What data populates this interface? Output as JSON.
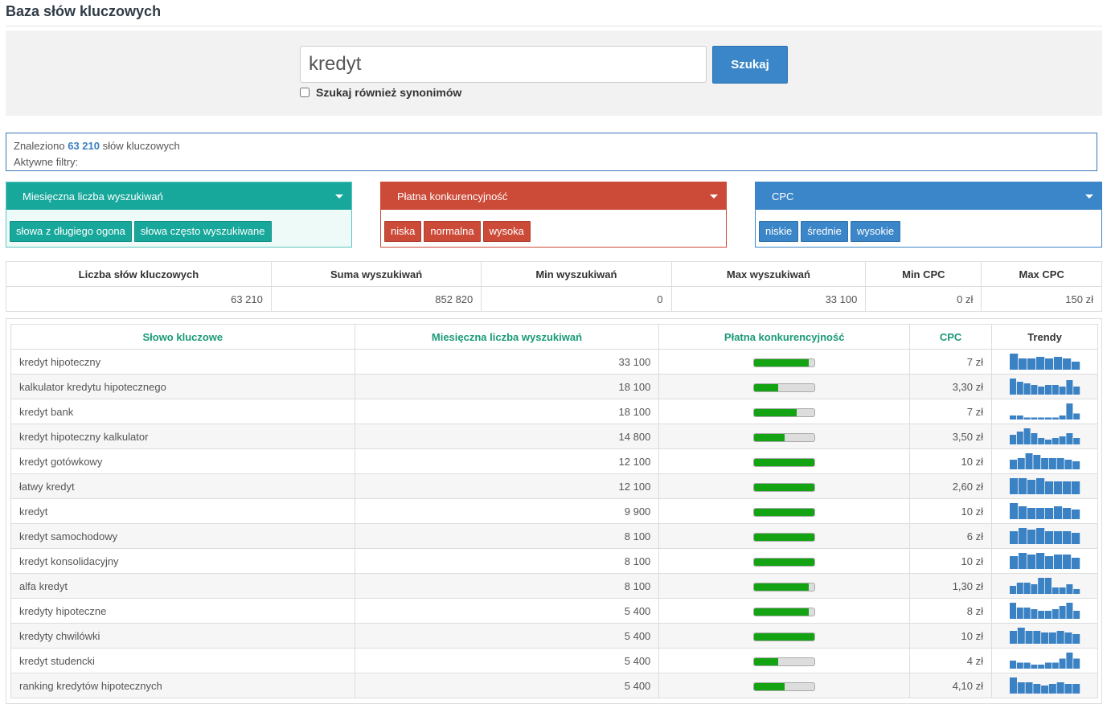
{
  "header": {
    "title": "Baza słów kluczowych"
  },
  "search": {
    "value": "kredyt",
    "button_label": "Szukaj",
    "synonyms_label": "Szukaj również synonimów"
  },
  "info": {
    "found_prefix": "Znaleziono",
    "found_count": "63 210",
    "found_suffix": "słów kluczowych",
    "active_filters": "Aktywne filtry:"
  },
  "filters": [
    {
      "title": "Miesięczna liczba wyszukiwań",
      "color": "#17a89b",
      "border": "#5cc7bd",
      "bg": "#eefaf8",
      "chips": [
        "słowa z długiego ogona",
        "słowa często wyszukiwane"
      ]
    },
    {
      "title": "Płatna konkurencyjność",
      "color": "#cc4a38",
      "border": "#cc4a38",
      "bg": "#fff",
      "chips": [
        "niska",
        "normalna",
        "wysoka"
      ]
    },
    {
      "title": "CPC",
      "color": "#3b86c8",
      "border": "#3b86c8",
      "bg": "#fff",
      "chips": [
        "niskie",
        "średnie",
        "wysokie"
      ]
    }
  ],
  "stats": {
    "headers": [
      "Liczba słów kluczowych",
      "Suma wyszukiwań",
      "Min wyszukiwań",
      "Max wyszukiwań",
      "Min CPC",
      "Max CPC"
    ],
    "values": [
      "63 210",
      "852 820",
      "0",
      "33 100",
      "0 zł",
      "150 zł"
    ]
  },
  "table": {
    "headers": [
      "Słowo kluczowe",
      "Miesięczna liczba wyszukiwań",
      "Płatna konkurencyjność",
      "CPC",
      "Trendy"
    ],
    "rows": [
      {
        "keyword": "kredyt hipoteczny",
        "searches": "33 100",
        "competition": 0.9,
        "cpc": "7 zł",
        "trend": [
          10,
          7,
          7,
          8,
          7,
          8,
          7,
          5
        ]
      },
      {
        "keyword": "kalkulator kredytu hipotecznego",
        "searches": "18 100",
        "competition": 0.4,
        "cpc": "3,30 zł",
        "trend": [
          10,
          8,
          7,
          6,
          5,
          6,
          6,
          5,
          9,
          5
        ]
      },
      {
        "keyword": "kredyt bank",
        "searches": "18 100",
        "competition": 0.7,
        "cpc": "7 zł",
        "trend": [
          2,
          2,
          1,
          1,
          1,
          1,
          1,
          2,
          8,
          3
        ]
      },
      {
        "keyword": "kredyt hipoteczny kalkulator",
        "searches": "14 800",
        "competition": 0.5,
        "cpc": "3,50 zł",
        "trend": [
          6,
          8,
          10,
          7,
          4,
          3,
          4,
          5,
          7,
          4
        ]
      },
      {
        "keyword": "kredyt gotówkowy",
        "searches": "12 100",
        "competition": 1.0,
        "cpc": "10 zł",
        "trend": [
          6,
          7,
          10,
          9,
          7,
          7,
          7,
          6,
          5
        ]
      },
      {
        "keyword": "łatwy kredyt",
        "searches": "12 100",
        "competition": 1.0,
        "cpc": "2,60 zł",
        "trend": [
          10,
          10,
          9,
          10,
          8,
          8,
          8,
          8
        ]
      },
      {
        "keyword": "kredyt",
        "searches": "9 900",
        "competition": 1.0,
        "cpc": "10 zł",
        "trend": [
          10,
          8,
          7,
          7,
          7,
          8,
          7,
          6
        ]
      },
      {
        "keyword": "kredyt samochodowy",
        "searches": "8 100",
        "competition": 1.0,
        "cpc": "6 zł",
        "trend": [
          8,
          10,
          9,
          10,
          8,
          8,
          8,
          7
        ]
      },
      {
        "keyword": "kredyt konsolidacyjny",
        "searches": "8 100",
        "competition": 1.0,
        "cpc": "10 zł",
        "trend": [
          8,
          10,
          9,
          10,
          8,
          9,
          9,
          7
        ]
      },
      {
        "keyword": "alfa kredyt",
        "searches": "8 100",
        "competition": 0.9,
        "cpc": "1,30 zł",
        "trend": [
          5,
          7,
          7,
          6,
          10,
          10,
          4,
          4,
          6,
          3
        ]
      },
      {
        "keyword": "kredyty hipoteczne",
        "searches": "5 400",
        "competition": 0.9,
        "cpc": "8 zł",
        "trend": [
          10,
          7,
          7,
          6,
          5,
          5,
          6,
          8,
          10,
          5
        ]
      },
      {
        "keyword": "kredyty chwilówki",
        "searches": "5 400",
        "competition": 1.0,
        "cpc": "10 zł",
        "trend": [
          8,
          10,
          8,
          8,
          7,
          7,
          8,
          7,
          6
        ]
      },
      {
        "keyword": "kredyt studencki",
        "searches": "5 400",
        "competition": 0.4,
        "cpc": "4 zł",
        "trend": [
          4,
          3,
          3,
          2,
          2,
          3,
          3,
          5,
          8,
          5
        ]
      },
      {
        "keyword": "ranking kredytów hipotecznych",
        "searches": "5 400",
        "competition": 0.5,
        "cpc": "4,10 zł",
        "trend": [
          10,
          7,
          7,
          6,
          5,
          6,
          7,
          6,
          6
        ]
      }
    ]
  }
}
